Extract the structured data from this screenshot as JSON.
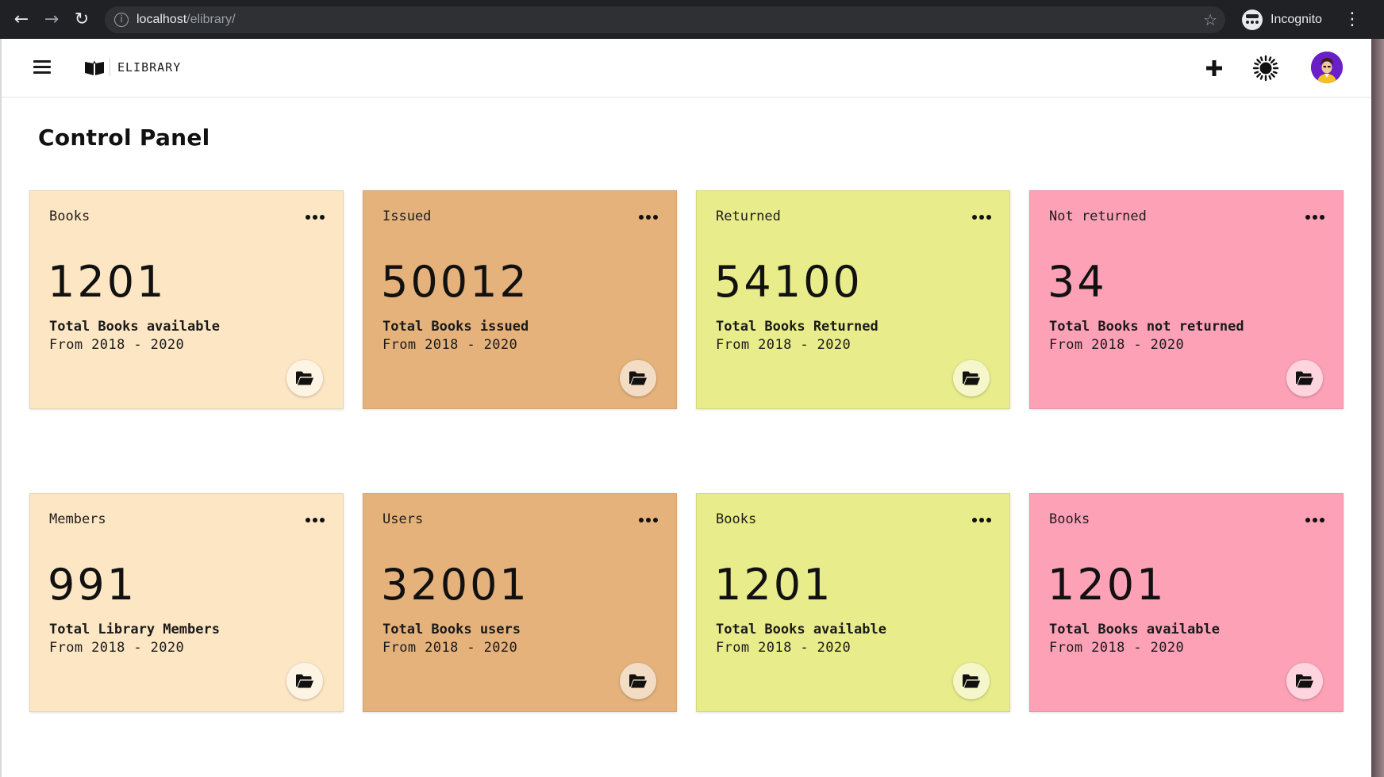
{
  "browser": {
    "url_host": "localhost",
    "url_path": "/elibrary/",
    "profile_label": "Incognito"
  },
  "app": {
    "brand": "ELIBRARY",
    "icons": {
      "menu": "hamburger-icon",
      "logo": "open-book-icon",
      "add": "plus-icon",
      "theme": "sun-icon",
      "avatar": "user-avatar"
    }
  },
  "main": {
    "title": "Control Panel"
  },
  "cards": [
    {
      "label": "Books",
      "value": "1201",
      "desc": "Total Books available",
      "range": "From 2018 - 2020",
      "color": "#fde6c4"
    },
    {
      "label": "Issued",
      "value": "50012",
      "desc": "Total Books issued",
      "range": "From 2018 - 2020",
      "color": "#e5b27c"
    },
    {
      "label": "Returned",
      "value": "54100",
      "desc": "Total Books Returned",
      "range": "From 2018 - 2020",
      "color": "#e8ec8a"
    },
    {
      "label": "Not returned",
      "value": "34",
      "desc": "Total Books not returned",
      "range": "From 2018 - 2020",
      "color": "#fda1b7"
    },
    {
      "label": "Members",
      "value": "991",
      "desc": "Total Library Members",
      "range": "From 2018 - 2020",
      "color": "#fde6c4"
    },
    {
      "label": "Users",
      "value": "32001",
      "desc": "Total Books users",
      "range": "From 2018 - 2020",
      "color": "#e5b27c"
    },
    {
      "label": "Books",
      "value": "1201",
      "desc": "Total Books available",
      "range": "From 2018 - 2020",
      "color": "#e8ec8a"
    },
    {
      "label": "Books",
      "value": "1201",
      "desc": "Total Books available",
      "range": "From 2018 - 2020",
      "color": "#fda1b7"
    }
  ]
}
